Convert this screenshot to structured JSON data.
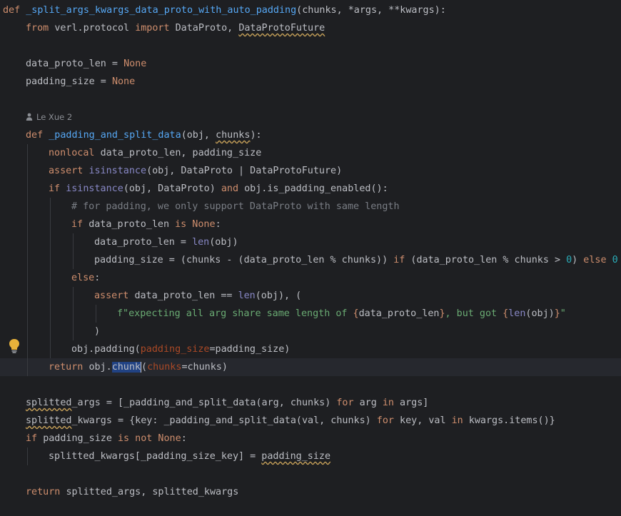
{
  "editor": {
    "background": "#1e1f22",
    "author_hint": {
      "icon": "person-icon",
      "text": "Le Xue 2"
    },
    "gutter_icon": "lightbulb-icon",
    "lines": [
      {
        "indent": 0,
        "tokens": [
          {
            "t": "def ",
            "c": "kw"
          },
          {
            "t": "_split_args_kwargs_data_proto_with_auto_padding",
            "c": "fn"
          },
          {
            "t": "(chunks, *args, **kwargs):",
            "c": ""
          }
        ]
      },
      {
        "indent": 1,
        "tokens": [
          {
            "t": "from ",
            "c": "kw"
          },
          {
            "t": "verl.protocol ",
            "c": ""
          },
          {
            "t": "import ",
            "c": "kw"
          },
          {
            "t": "DataProto, ",
            "c": ""
          },
          {
            "t": "DataProtoFuture",
            "c": "sq"
          }
        ]
      },
      {
        "indent": 0,
        "tokens": []
      },
      {
        "indent": 1,
        "tokens": [
          {
            "t": "data_proto_len = ",
            "c": ""
          },
          {
            "t": "None",
            "c": "kw"
          }
        ]
      },
      {
        "indent": 1,
        "tokens": [
          {
            "t": "padding_size = ",
            "c": ""
          },
          {
            "t": "None",
            "c": "kw"
          }
        ]
      },
      {
        "indent": 0,
        "tokens": []
      },
      {
        "indent": 0,
        "tokens": [],
        "hint": true
      },
      {
        "indent": 1,
        "tokens": [
          {
            "t": "def ",
            "c": "kw"
          },
          {
            "t": "_padding_and_split_data",
            "c": "fn"
          },
          {
            "t": "(obj, ",
            "c": ""
          },
          {
            "t": "chunks",
            "c": "sq"
          },
          {
            "t": "):",
            "c": ""
          }
        ]
      },
      {
        "indent": 2,
        "tokens": [
          {
            "t": "nonlocal ",
            "c": "kw"
          },
          {
            "t": "data_proto_len, padding_size",
            "c": ""
          }
        ]
      },
      {
        "indent": 2,
        "tokens": [
          {
            "t": "assert ",
            "c": "kw"
          },
          {
            "t": "isinstance",
            "c": "bi"
          },
          {
            "t": "(obj, DataProto | DataProtoFuture)",
            "c": ""
          }
        ]
      },
      {
        "indent": 2,
        "tokens": [
          {
            "t": "if ",
            "c": "kw"
          },
          {
            "t": "isinstance",
            "c": "bi"
          },
          {
            "t": "(obj, DataProto) ",
            "c": ""
          },
          {
            "t": "and ",
            "c": "kw"
          },
          {
            "t": "obj.is_padding_enabled():",
            "c": ""
          }
        ]
      },
      {
        "indent": 3,
        "tokens": [
          {
            "t": "# for padding, we only support DataProto with same length",
            "c": "cm"
          }
        ]
      },
      {
        "indent": 3,
        "tokens": [
          {
            "t": "if ",
            "c": "kw"
          },
          {
            "t": "data_proto_len ",
            "c": ""
          },
          {
            "t": "is None",
            "c": "kw"
          },
          {
            "t": ":",
            "c": ""
          }
        ]
      },
      {
        "indent": 4,
        "tokens": [
          {
            "t": "data_proto_len = ",
            "c": ""
          },
          {
            "t": "len",
            "c": "bi"
          },
          {
            "t": "(obj)",
            "c": ""
          }
        ]
      },
      {
        "indent": 4,
        "tokens": [
          {
            "t": "padding_size = (chunks - (data_proto_len % chunks)) ",
            "c": ""
          },
          {
            "t": "if ",
            "c": "kw"
          },
          {
            "t": "(data_proto_len % chunks > ",
            "c": ""
          },
          {
            "t": "0",
            "c": "nu"
          },
          {
            "t": ") ",
            "c": ""
          },
          {
            "t": "else ",
            "c": "kw"
          },
          {
            "t": "0",
            "c": "nu"
          }
        ]
      },
      {
        "indent": 3,
        "tokens": [
          {
            "t": "else",
            "c": "kw"
          },
          {
            "t": ":",
            "c": ""
          }
        ]
      },
      {
        "indent": 4,
        "tokens": [
          {
            "t": "assert ",
            "c": "kw"
          },
          {
            "t": "data_proto_len == ",
            "c": ""
          },
          {
            "t": "len",
            "c": "bi"
          },
          {
            "t": "(obj), (",
            "c": ""
          }
        ]
      },
      {
        "indent": 5,
        "tokens": [
          {
            "t": "f\"expecting all arg share same length of ",
            "c": "st"
          },
          {
            "t": "{",
            "c": "kw"
          },
          {
            "t": "data_proto_len",
            "c": ""
          },
          {
            "t": "}",
            "c": "kw"
          },
          {
            "t": ", but got ",
            "c": "st"
          },
          {
            "t": "{",
            "c": "kw"
          },
          {
            "t": "len",
            "c": "bi"
          },
          {
            "t": "(obj)",
            "c": ""
          },
          {
            "t": "}",
            "c": "kw"
          },
          {
            "t": "\"",
            "c": "st"
          }
        ]
      },
      {
        "indent": 4,
        "tokens": [
          {
            "t": ")",
            "c": ""
          }
        ]
      },
      {
        "indent": 3,
        "tokens": [
          {
            "t": "obj.padding(",
            "c": ""
          },
          {
            "t": "padding_size",
            "c": "pm"
          },
          {
            "t": "=padding_size)",
            "c": ""
          }
        ]
      },
      {
        "indent": 2,
        "current": true,
        "tokens": [
          {
            "t": "return ",
            "c": "kw"
          },
          {
            "t": "obj.",
            "c": ""
          },
          {
            "t": "chunk",
            "c": "sel"
          },
          {
            "t": "(",
            "c": ""
          },
          {
            "t": "chunks",
            "c": "pm"
          },
          {
            "t": "=chunks)",
            "c": ""
          }
        ]
      },
      {
        "indent": 0,
        "tokens": []
      },
      {
        "indent": 1,
        "tokens": [
          {
            "t": "splitted",
            "c": "sq"
          },
          {
            "t": "_args = [_padding_and_split_data(arg, chunks) ",
            "c": ""
          },
          {
            "t": "for ",
            "c": "kw"
          },
          {
            "t": "arg ",
            "c": ""
          },
          {
            "t": "in ",
            "c": "kw"
          },
          {
            "t": "args]",
            "c": ""
          }
        ]
      },
      {
        "indent": 1,
        "tokens": [
          {
            "t": "splitted",
            "c": "sq"
          },
          {
            "t": "_kwargs = {key: _padding_and_split_data(val, chunks) ",
            "c": ""
          },
          {
            "t": "for ",
            "c": "kw"
          },
          {
            "t": "key, val ",
            "c": ""
          },
          {
            "t": "in ",
            "c": "kw"
          },
          {
            "t": "kwargs.items()}",
            "c": ""
          }
        ]
      },
      {
        "indent": 1,
        "tokens": [
          {
            "t": "if ",
            "c": "kw"
          },
          {
            "t": "padding_size ",
            "c": ""
          },
          {
            "t": "is not None",
            "c": "kw"
          },
          {
            "t": ":",
            "c": ""
          }
        ]
      },
      {
        "indent": 2,
        "tokens": [
          {
            "t": "splitted_kwargs[_padding_size_key] = ",
            "c": ""
          },
          {
            "t": "padding_size",
            "c": "sq"
          }
        ]
      },
      {
        "indent": 0,
        "tokens": []
      },
      {
        "indent": 1,
        "tokens": [
          {
            "t": "return ",
            "c": "kw"
          },
          {
            "t": "splitted_args, splitted_kwargs",
            "c": ""
          }
        ]
      }
    ]
  }
}
